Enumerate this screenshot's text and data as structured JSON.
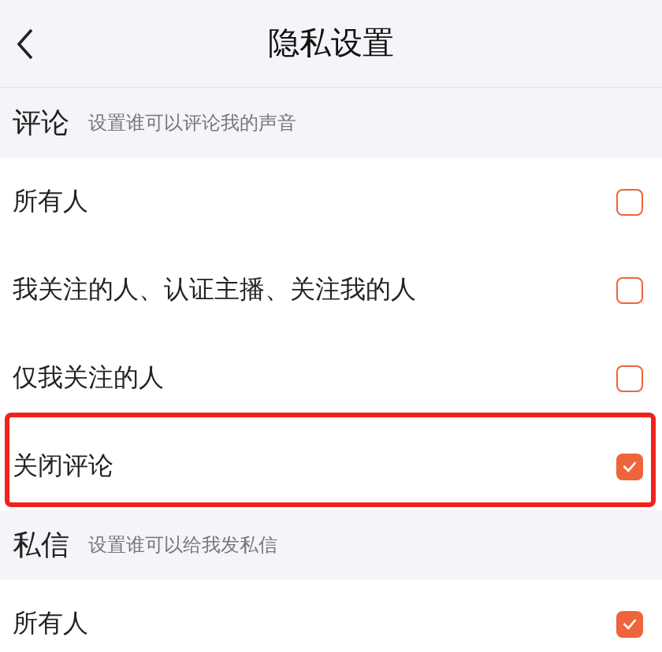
{
  "header": {
    "title": "隐私设置"
  },
  "sections": [
    {
      "title": "评论",
      "subtitle": "设置谁可以评论我的声音",
      "options": [
        {
          "label": "所有人",
          "checked": false,
          "highlighted": false
        },
        {
          "label": "我关注的人、认证主播、关注我的人",
          "checked": false,
          "highlighted": false
        },
        {
          "label": "仅我关注的人",
          "checked": false,
          "highlighted": false
        },
        {
          "label": "关闭评论",
          "checked": true,
          "highlighted": true
        }
      ]
    },
    {
      "title": "私信",
      "subtitle": "设置谁可以给我发私信",
      "options": [
        {
          "label": "所有人",
          "checked": true,
          "highlighted": false
        }
      ]
    }
  ]
}
